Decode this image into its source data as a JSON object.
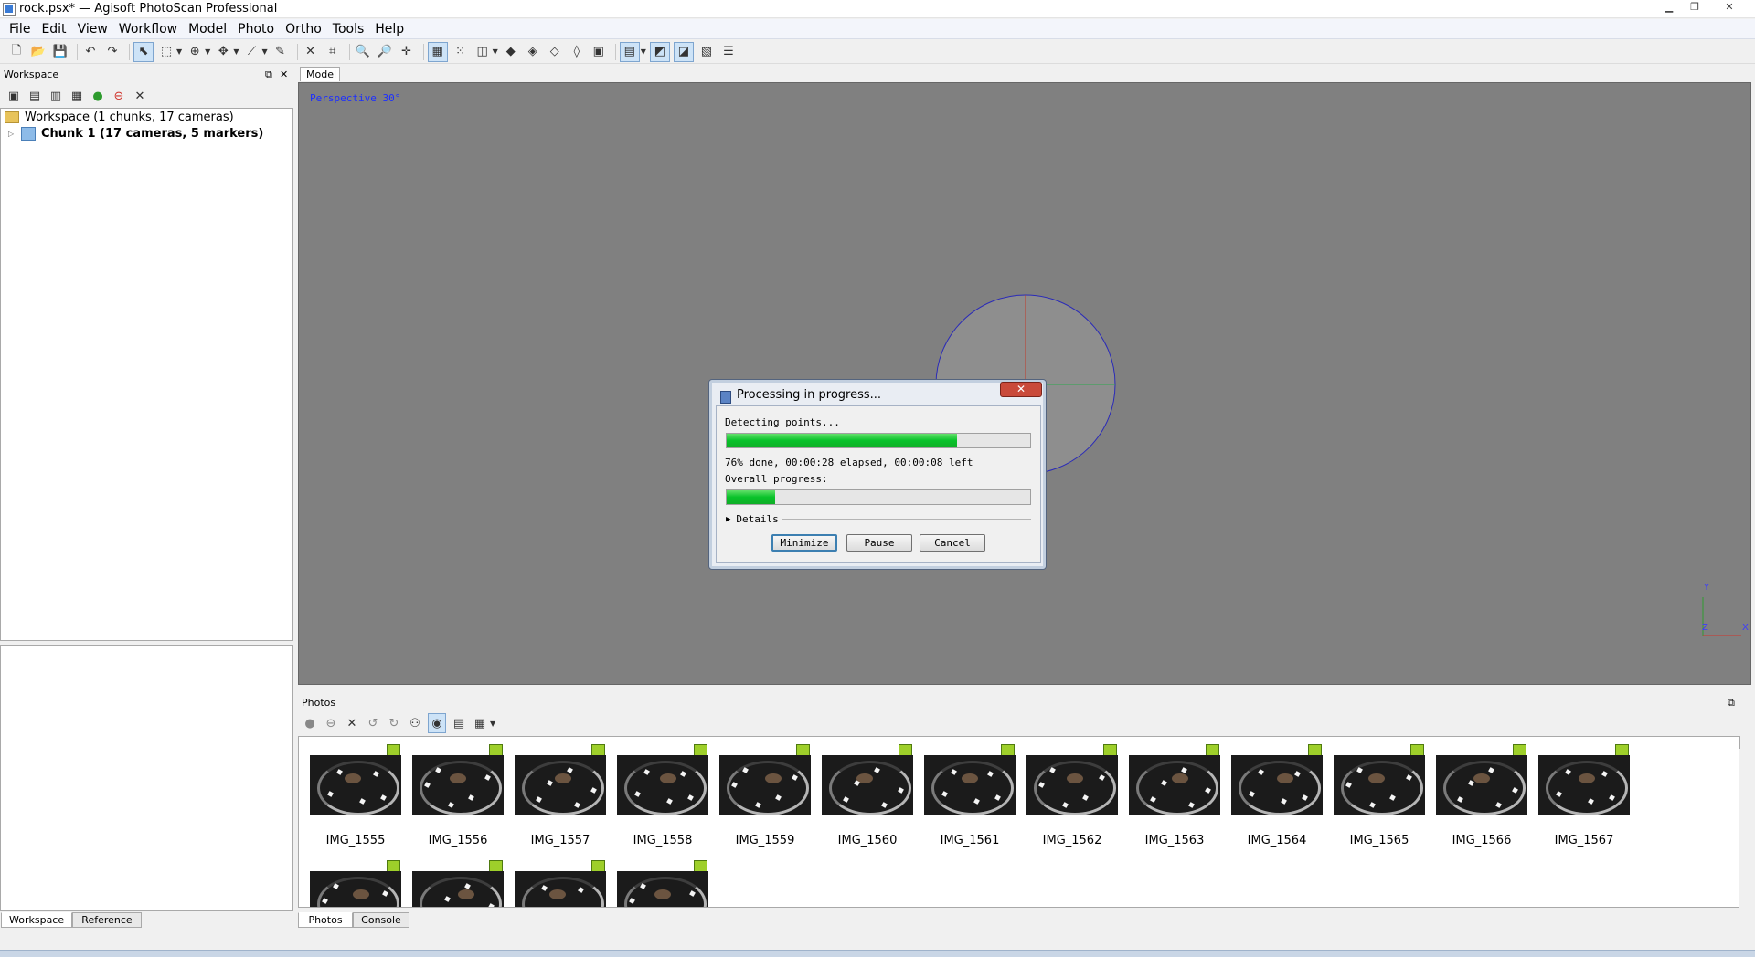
{
  "window": {
    "title": "rock.psx* — Agisoft PhotoScan Professional"
  },
  "menu": [
    "File",
    "Edit",
    "View",
    "Workflow",
    "Model",
    "Photo",
    "Ortho",
    "Tools",
    "Help"
  ],
  "workspace": {
    "header": "Workspace",
    "tree": {
      "root": "Workspace (1 chunks, 17 cameras)",
      "chunk": "Chunk 1 (17 cameras, 5 markers)"
    }
  },
  "bottom_tabs_left": [
    "Workspace",
    "Reference"
  ],
  "viewport": {
    "tab": "Model",
    "projection_label": "Perspective 30°",
    "axes": {
      "x": "X",
      "y": "Y",
      "z": "Z"
    },
    "colors": {
      "background": "#808080",
      "trackball": "#2a2ab8"
    }
  },
  "photos": {
    "header": "Photos",
    "items": [
      "IMG_1555",
      "IMG_1556",
      "IMG_1557",
      "IMG_1558",
      "IMG_1559",
      "IMG_1560",
      "IMG_1561",
      "IMG_1562",
      "IMG_1563",
      "IMG_1564",
      "IMG_1565",
      "IMG_1566",
      "IMG_1567",
      "",
      "",
      "",
      ""
    ],
    "flag_color": "#9ecf2a"
  },
  "bottom_tabs_right": [
    "Photos",
    "Console"
  ],
  "dialog": {
    "title": "Processing in progress...",
    "status": "Detecting points...",
    "progress_fraction": 0.76,
    "progress_text": "76% done, 00:00:28 elapsed, 00:00:08 left",
    "overall_label": "Overall progress:",
    "overall_fraction": 0.16,
    "details_label": "Details",
    "buttons": {
      "minimize": "Minimize",
      "pause": "Pause",
      "cancel": "Cancel"
    },
    "close_glyph": "✕",
    "colors": {
      "progress": "#08c22a"
    }
  },
  "icons": {
    "toolbar": [
      "new-icon",
      "open-icon",
      "save-icon",
      "undo-icon",
      "redo-icon",
      "select-icon",
      "rect-select-icon",
      "navigation-icon",
      "move-region-icon",
      "ruler-icon",
      "delete-icon",
      "crop-icon",
      "zoom-in-icon",
      "zoom-out-icon",
      "move-icon",
      "grid-icon",
      "dots-icon",
      "shading-icon",
      "top-view-icon",
      "front-view-icon",
      "side-view-icon",
      "bottom-view-icon",
      "cameras-icon",
      "snapshot-icon",
      "model-view-icon",
      "photo-view-icon",
      "ortho-icon",
      "layers-icon"
    ]
  }
}
